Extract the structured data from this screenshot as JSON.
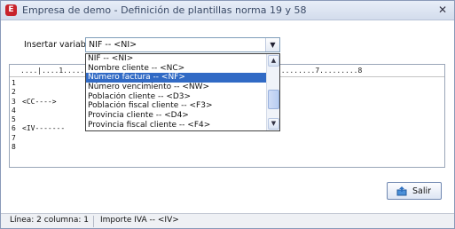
{
  "window": {
    "title": "Empresa de demo - Definición de plantillas norma 19 y 58",
    "close_glyph": "✕",
    "app_icon_letter": "E"
  },
  "insert_variable": {
    "label": "Insertar variable",
    "selected_value": "NIF -- <NI>",
    "options": [
      "NIF -- <NI>",
      "Nombre cliente -- <NC>",
      "Número factura -- <NF>",
      "Número vencimiento -- <NW>",
      "Población cliente -- <D3>",
      "Población fiscal cliente -- <F3>",
      "Provincia cliente -- <D4>",
      "Provincia fiscal cliente -- <F4>"
    ],
    "highlighted_index": 2
  },
  "editor": {
    "ruler_text": "....|....1.........2.........3.........4.........5.........6.........7.........8",
    "line_numbers": [
      "1",
      "2",
      "3",
      "4",
      "5",
      "6",
      "7",
      "8"
    ],
    "lines": [
      "<CC---->",
      "<IV-------",
      "",
      "",
      "",
      "",
      "",
      ""
    ]
  },
  "buttons": {
    "exit_label": "Salir",
    "exit_icon": "exit-icon"
  },
  "status": {
    "position": "Línea: 2  columna: 1",
    "field": "Importe IVA -- <IV>"
  },
  "colors": {
    "selection": "#316ac5",
    "app_icon": "#c8232b"
  }
}
